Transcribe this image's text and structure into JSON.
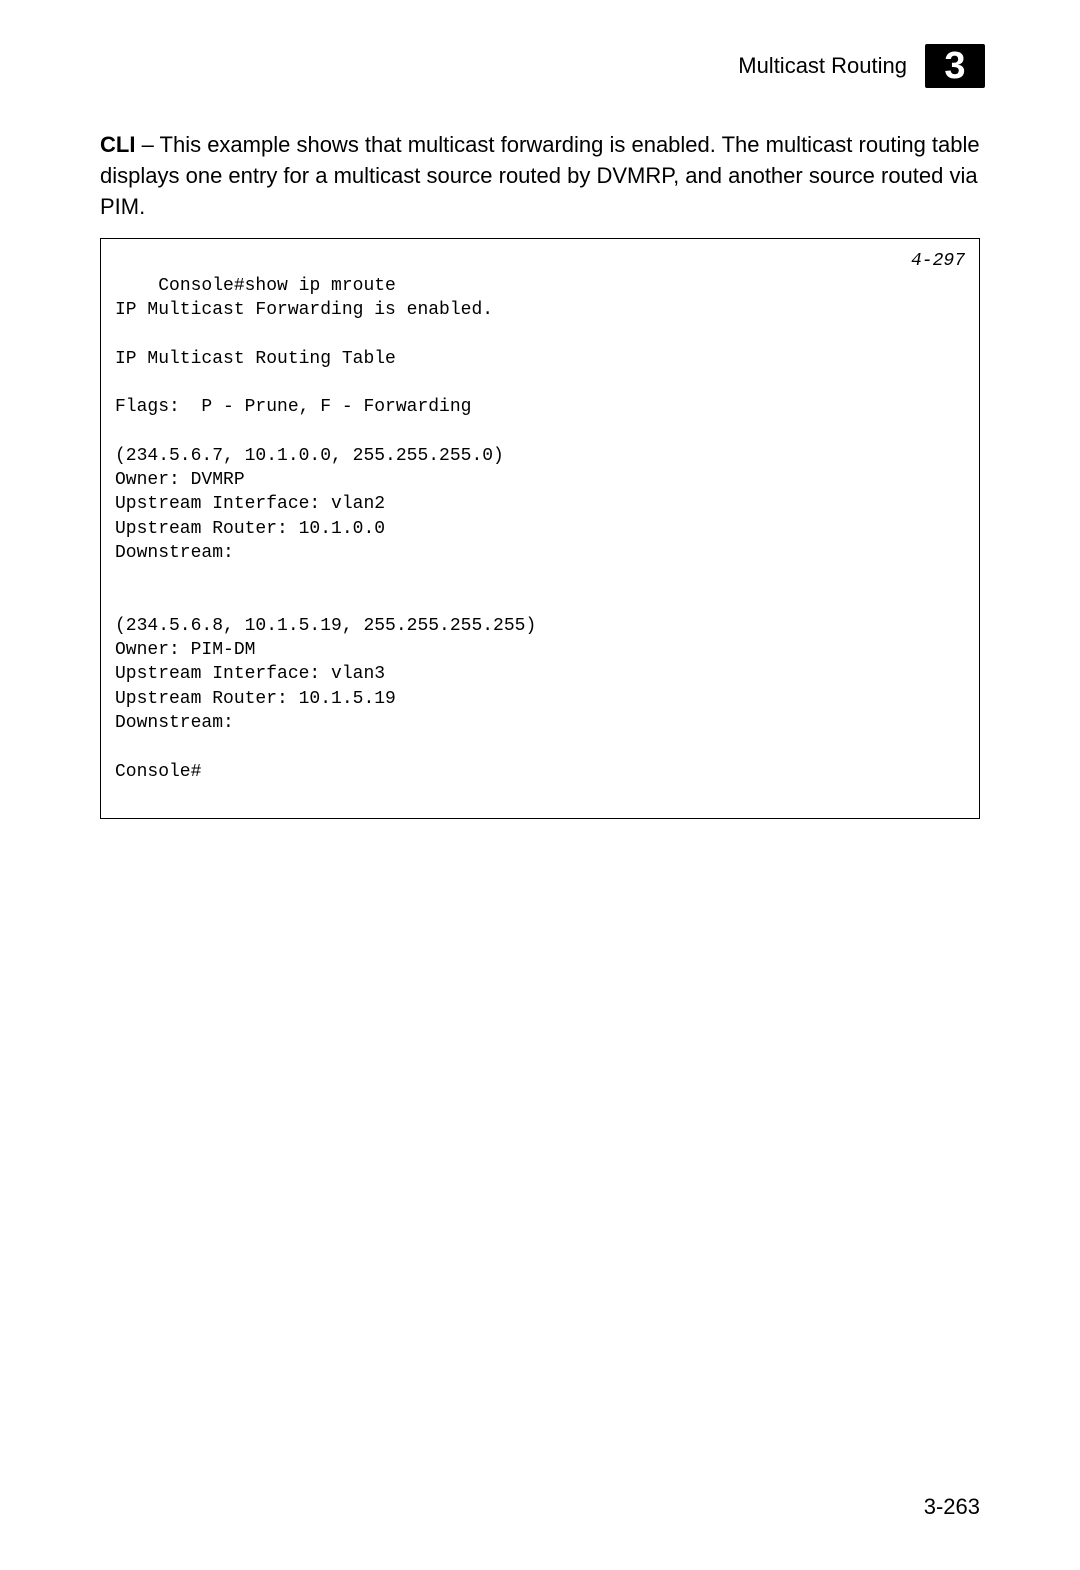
{
  "header": {
    "title": "Multicast Routing",
    "chapter": "3"
  },
  "body": {
    "cli_label": "CLI",
    "paragraph_text": " – This example shows that multicast forwarding is enabled. The multicast routing table displays one entry for a multicast source routed by DVMRP, and another source routed via PIM."
  },
  "code": {
    "ref": "4-297",
    "lines": "Console#show ip mroute\nIP Multicast Forwarding is enabled.\n\nIP Multicast Routing Table\n\nFlags:  P - Prune, F - Forwarding\n\n(234.5.6.7, 10.1.0.0, 255.255.255.0)\nOwner: DVMRP\nUpstream Interface: vlan2\nUpstream Router: 10.1.0.0\nDownstream:\n\n\n(234.5.6.8, 10.1.5.19, 255.255.255.255)\nOwner: PIM-DM\nUpstream Interface: vlan3\nUpstream Router: 10.1.5.19\nDownstream:\n\nConsole#"
  },
  "footer": {
    "page_number": "3-263"
  }
}
